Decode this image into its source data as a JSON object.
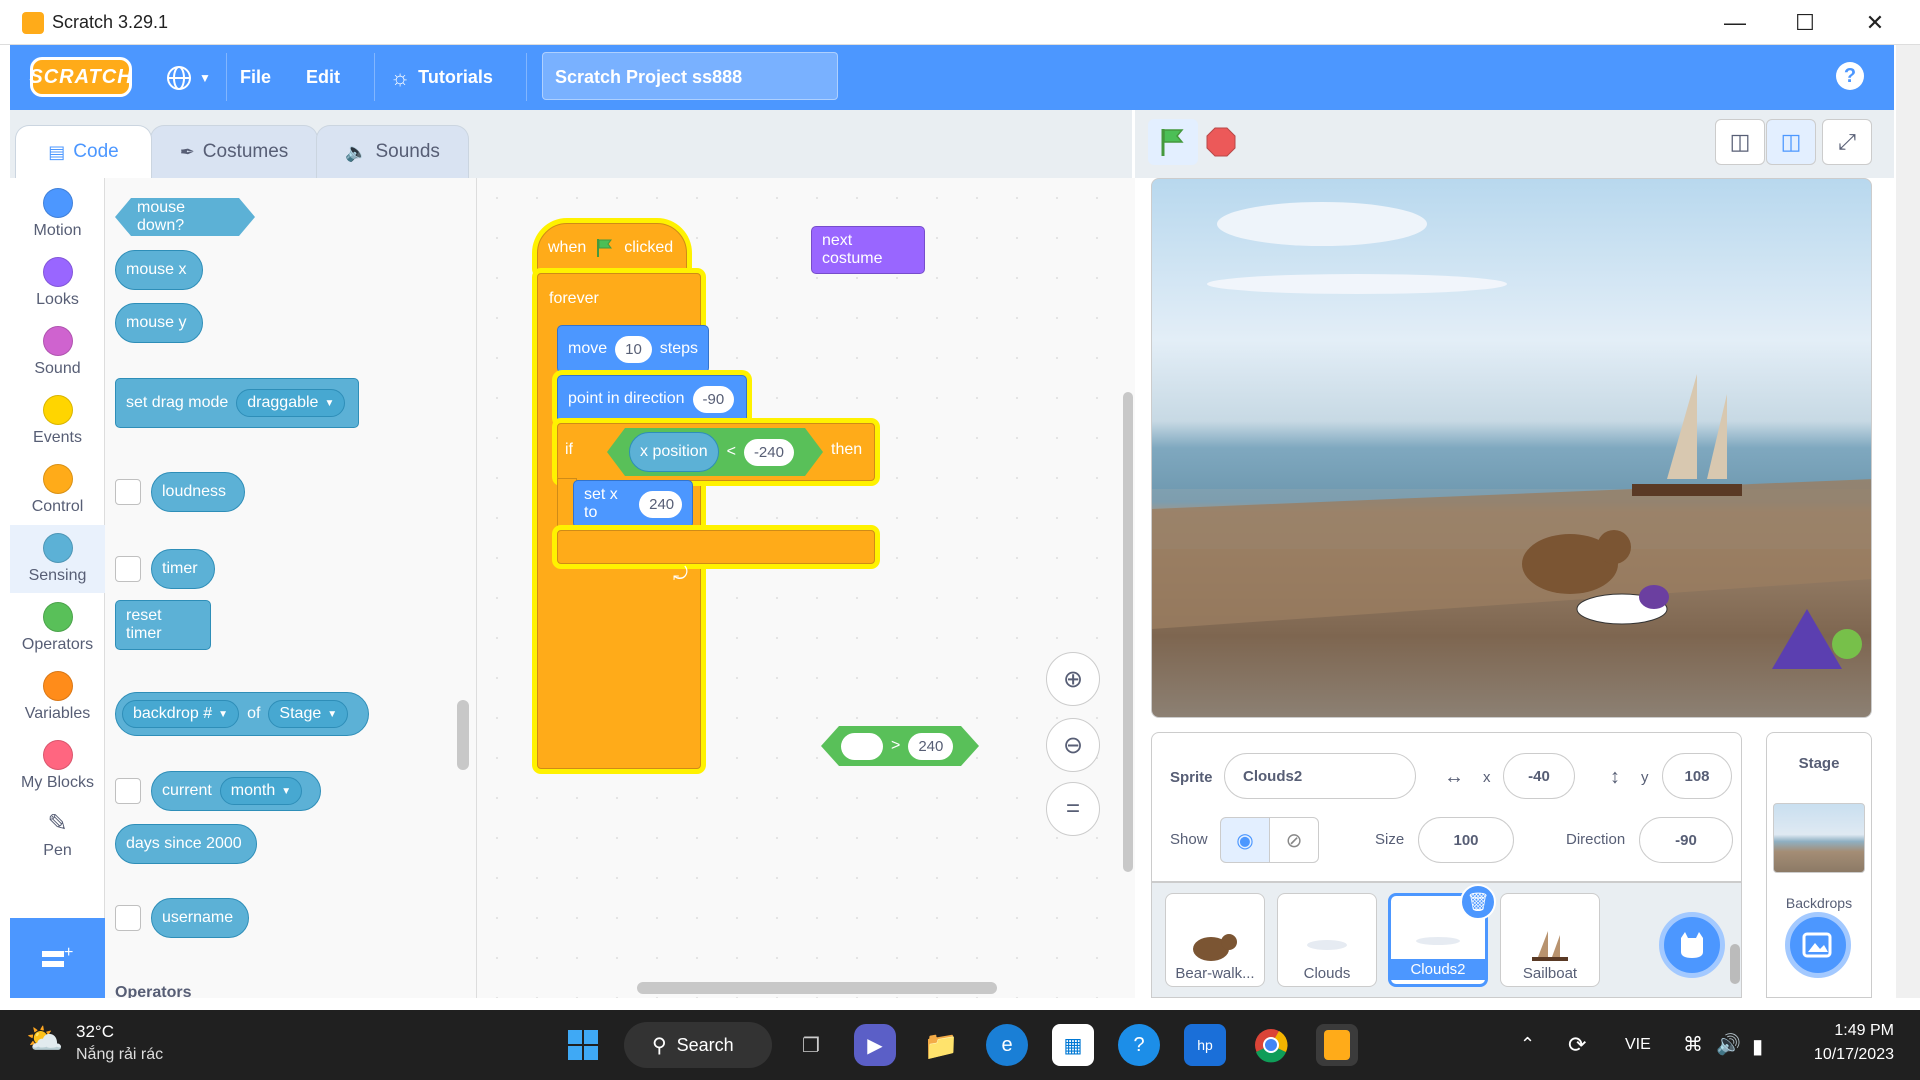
{
  "window": {
    "title": "Scratch 3.29.1"
  },
  "menubar": {
    "logo": "SCRATCH",
    "file": "File",
    "edit": "Edit",
    "tutorials": "Tutorials",
    "project_title": "Scratch Project ss888",
    "help": "?"
  },
  "tabs": [
    {
      "label": "Code"
    },
    {
      "label": "Costumes"
    },
    {
      "label": "Sounds"
    }
  ],
  "categories": [
    {
      "label": "Motion",
      "color": "#4c97ff"
    },
    {
      "label": "Looks",
      "color": "#9966ff"
    },
    {
      "label": "Sound",
      "color": "#cf63cf"
    },
    {
      "label": "Events",
      "color": "#ffd500"
    },
    {
      "label": "Control",
      "color": "#ffab19"
    },
    {
      "label": "Sensing",
      "color": "#5cb1d6"
    },
    {
      "label": "Operators",
      "color": "#59c059"
    },
    {
      "label": "Variables",
      "color": "#ff8c1a"
    },
    {
      "label": "My Blocks",
      "color": "#ff6680"
    },
    {
      "label": "Pen",
      "color": "#0fbd8c"
    }
  ],
  "palette": {
    "mouse_down": "mouse down?",
    "mouse_x": "mouse x",
    "mouse_y": "mouse y",
    "set_drag_mode": "set drag mode",
    "draggable": "draggable",
    "loudness": "loudness",
    "timer": "timer",
    "reset_timer": "reset timer",
    "backdrop_num": "backdrop #",
    "of": "of",
    "stage": "Stage",
    "current": "current",
    "month": "month",
    "days_since": "days since 2000",
    "username": "username",
    "operators_heading": "Operators"
  },
  "script": {
    "when": "when",
    "clicked": "clicked",
    "forever": "forever",
    "move": "move",
    "move_steps": "10",
    "steps": "steps",
    "point_in_direction": "point in direction",
    "direction_value": "-90",
    "if": "if",
    "x_position": "x position",
    "lt": "<",
    "lt_value": "-240",
    "then": "then",
    "set_x_to": "set x to",
    "set_x_value": "240",
    "next_costume": "next costume",
    "gt": ">",
    "gt_value": "240"
  },
  "sprite_info": {
    "sprite_label": "Sprite",
    "sprite_name": "Clouds2",
    "x_label": "x",
    "x_value": "-40",
    "y_label": "y",
    "y_value": "108",
    "show_label": "Show",
    "size_label": "Size",
    "size_value": "100",
    "direction_label": "Direction",
    "direction_value": "-90"
  },
  "sprites": [
    {
      "name": "Bear-walk..."
    },
    {
      "name": "Clouds"
    },
    {
      "name": "Clouds2",
      "selected": true
    },
    {
      "name": "Sailboat"
    }
  ],
  "stage_pane": {
    "title": "Stage",
    "backdrops": "Backdrops"
  },
  "taskbar": {
    "temp": "32°C",
    "weather": "Nắng rải rác",
    "search": "Search",
    "lang": "VIE",
    "time": "1:49 PM",
    "date": "10/17/2023"
  }
}
